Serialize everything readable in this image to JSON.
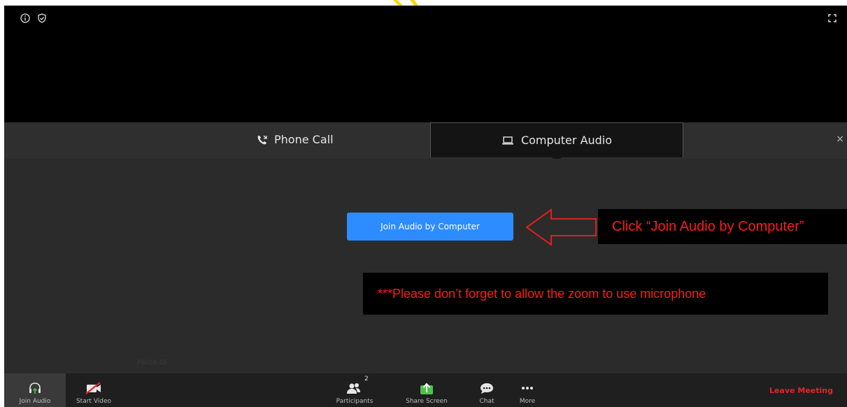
{
  "tabs": {
    "phone_call": "Phone Call",
    "computer_audio": "Computer Audio",
    "close": "×"
  },
  "main": {
    "join_button": "Join Audio by Computer",
    "callout": "Click “Join Audio by Computer”",
    "notice": "***Please don’t forget to allow the zoom to use microphone",
    "faint_name": "Paliza Oi"
  },
  "toolbar": {
    "join_audio": "Join Audio",
    "start_video": "Start Video",
    "participants": "Participants",
    "participants_count": "2",
    "share_screen": "Share Screen",
    "chat": "Chat",
    "more": "More",
    "leave": "Leave Meeting"
  },
  "colors": {
    "accent_blue": "#2d8cff",
    "annotation_red": "#ff1a1a",
    "leave_red": "#e02828",
    "share_green": "#4cc24c"
  },
  "icons": [
    "info-icon",
    "shield-icon",
    "fullscreen-icon",
    "phone-icon",
    "laptop-icon",
    "headphones-icon",
    "video-off-icon",
    "participants-icon",
    "share-screen-icon",
    "chat-icon",
    "more-icon",
    "arrow-annotation"
  ]
}
